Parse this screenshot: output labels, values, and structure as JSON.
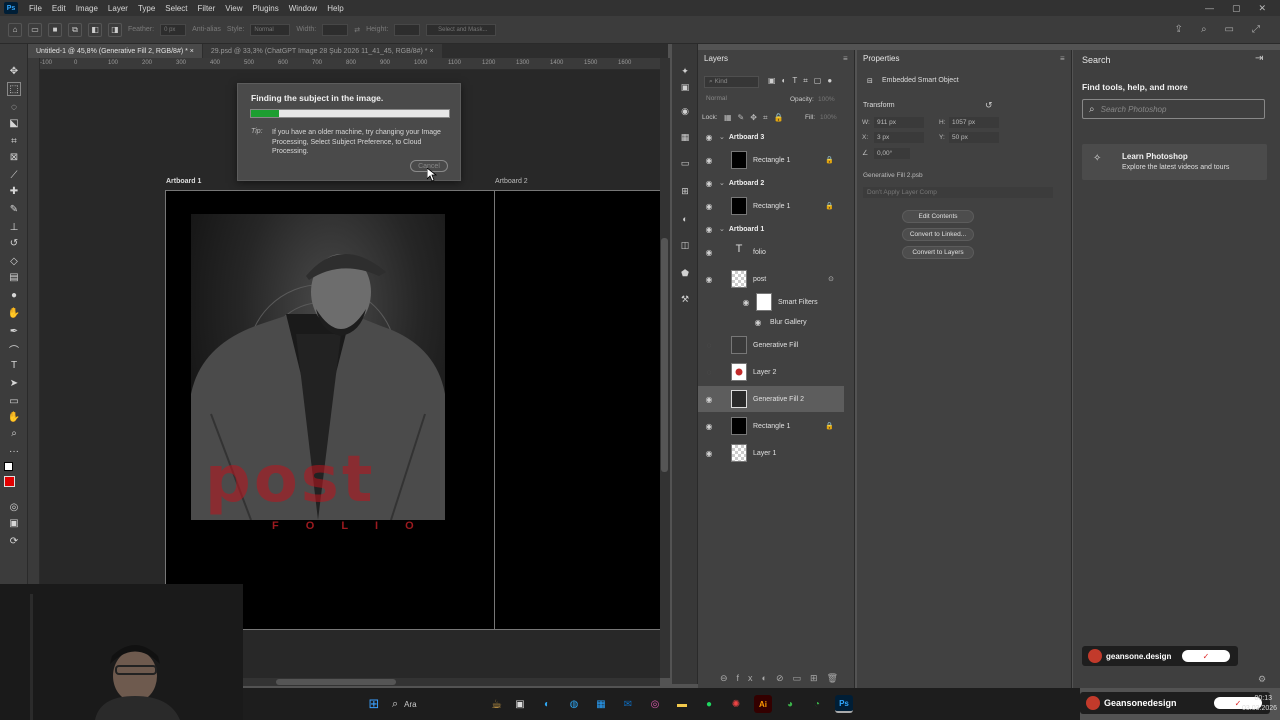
{
  "app": {
    "logo": "Ps",
    "menu": [
      "File",
      "Edit",
      "Image",
      "Layer",
      "Type",
      "Select",
      "Filter",
      "View",
      "Plugins",
      "Window",
      "Help"
    ]
  },
  "options_bar": {
    "feather_label": "Feather:",
    "feather_value": "0 px",
    "antialias_label": "Anti-alias",
    "style_label": "Style:",
    "style_value": "Normal",
    "width_label": "Width:",
    "height_label": "Height:",
    "select_mask_label": "Select and Mask..."
  },
  "tabs": [
    {
      "label": "Untitled-1 @ 45,8% (Generative Fill 2, RGB/8#) *",
      "close": "×"
    },
    {
      "label": "29.psd @ 33,3% (ChatGPT Image 28 Şub 2026 11_41_45, RGB/8#) *",
      "close": "×"
    }
  ],
  "ruler_h_labels": [
    "-100",
    "0",
    "100",
    "200",
    "300",
    "400",
    "500",
    "600",
    "700",
    "800",
    "900",
    "1000",
    "1100",
    "1200",
    "1300",
    "1400",
    "1500",
    "1600"
  ],
  "canvas": {
    "artboard1_label": "Artboard 1",
    "artboard2_label": "Artboard 2",
    "poster_title": "post",
    "poster_subtitle": "F O L I O"
  },
  "dialog": {
    "title": "Finding the subject in the image.",
    "progress": 0.14,
    "tip_label": "Tip:",
    "tip_text": "If you have an older machine, try changing your Image Processing, Select Subject Preference, to Cloud Processing.",
    "cancel_label": "Cancel"
  },
  "layers_panel": {
    "title": "Layers",
    "kind_placeholder": "Kind",
    "blend_mode": "Normal",
    "opacity_label": "Opacity:",
    "opacity_value": "100%",
    "lock_label": "Lock:",
    "fill_label": "Fill:",
    "fill_value": "100%",
    "rows": [
      {
        "type": "group",
        "name": "Artboard 3"
      },
      {
        "type": "layer",
        "name": "Rectangle 1",
        "locked": true
      },
      {
        "type": "group",
        "name": "Artboard 2"
      },
      {
        "type": "layer",
        "name": "Rectangle 1",
        "locked": true
      },
      {
        "type": "group",
        "name": "Artboard 1"
      },
      {
        "type": "text",
        "name": "folio"
      },
      {
        "type": "layer",
        "name": "post"
      },
      {
        "type": "sub",
        "name": "Smart Filters"
      },
      {
        "type": "sub",
        "name": "Blur Gallery"
      },
      {
        "type": "layer",
        "name": "Generative Fill"
      },
      {
        "type": "layer",
        "name": "Layer 2"
      },
      {
        "type": "layer",
        "name": "Generative Fill 2",
        "selected": true
      },
      {
        "type": "layer",
        "name": "Rectangle 1",
        "locked": true
      },
      {
        "type": "layer",
        "name": "Layer 1"
      }
    ]
  },
  "properties_panel": {
    "title": "Properties",
    "object_type": "Embedded Smart Object",
    "transform_label": "Transform",
    "w_label": "W:",
    "w_value": "911 px",
    "h_label": "H:",
    "h_value": "1057 px",
    "x_label": "X:",
    "x_value": "3 px",
    "y_label": "Y:",
    "y_value": "50 px",
    "angle_value": "0,00°",
    "file_name": "Generative Fill 2.psb",
    "layer_comp": "Don't Apply Layer Comp",
    "buttons": [
      "Edit Contents",
      "Convert to Linked...",
      "Convert to Layers"
    ]
  },
  "search_panel": {
    "title": "Search",
    "heading": "Find tools, help, and more",
    "placeholder": "Search Photoshop",
    "card_title": "Learn Photoshop",
    "card_subtitle": "Explore the latest videos and tours"
  },
  "overlays": {
    "brand_small": "geansone.design",
    "brand_large": "Geansonedesign"
  },
  "taskbar": {
    "search_label": "Ara",
    "time": "00:13",
    "date": "03.03.2026"
  },
  "colors": {
    "accent_progress": "#1d9e31",
    "foreground_swatch": "#e00000",
    "poster_red": "#be141e"
  }
}
